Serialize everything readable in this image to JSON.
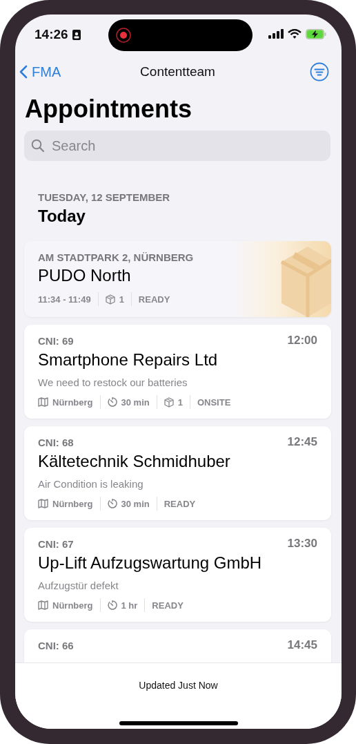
{
  "status_bar": {
    "time": "14:26"
  },
  "nav": {
    "back": "FMA",
    "title": "Contentteam"
  },
  "title": "Appointments",
  "search": {
    "placeholder": "Search"
  },
  "section": {
    "date": "TUESDAY, 12 SEPTEMBER",
    "heading": "Today"
  },
  "appointments": [
    {
      "kind": "pudo",
      "subtitle": "AM STADTPARK 2, NÜRNBERG",
      "name": "PUDO North",
      "meta": [
        {
          "kind": "plain",
          "text": "11:34 - 11:49"
        },
        {
          "kind": "box",
          "text": "1"
        },
        {
          "kind": "plain",
          "text": "READY"
        }
      ]
    },
    {
      "kind": "job",
      "subtitle": "CNI: 69",
      "time": "12:00",
      "name": "Smartphone Repairs Ltd",
      "note": "We need to restock our batteries",
      "meta": [
        {
          "kind": "map",
          "text": "Nürnberg"
        },
        {
          "kind": "clock",
          "text": "30 min"
        },
        {
          "kind": "box",
          "text": "1"
        },
        {
          "kind": "plain",
          "text": "ONSITE"
        }
      ]
    },
    {
      "kind": "job",
      "subtitle": "CNI: 68",
      "time": "12:45",
      "name": "Kältetechnik Schmidhuber",
      "note": "Air Condition is leaking",
      "meta": [
        {
          "kind": "map",
          "text": "Nürnberg"
        },
        {
          "kind": "clock",
          "text": "30 min"
        },
        {
          "kind": "plain",
          "text": "READY"
        }
      ]
    },
    {
      "kind": "job",
      "subtitle": "CNI: 67",
      "time": "13:30",
      "name": "Up-Lift Aufzugswartung GmbH",
      "note": "Aufzugstür defekt",
      "meta": [
        {
          "kind": "map",
          "text": "Nürnberg"
        },
        {
          "kind": "clock",
          "text": "1 hr"
        },
        {
          "kind": "plain",
          "text": "READY"
        }
      ]
    },
    {
      "kind": "job",
      "subtitle": "CNI: 66",
      "time": "14:45"
    }
  ],
  "footer": {
    "text": "Updated Just Now"
  }
}
